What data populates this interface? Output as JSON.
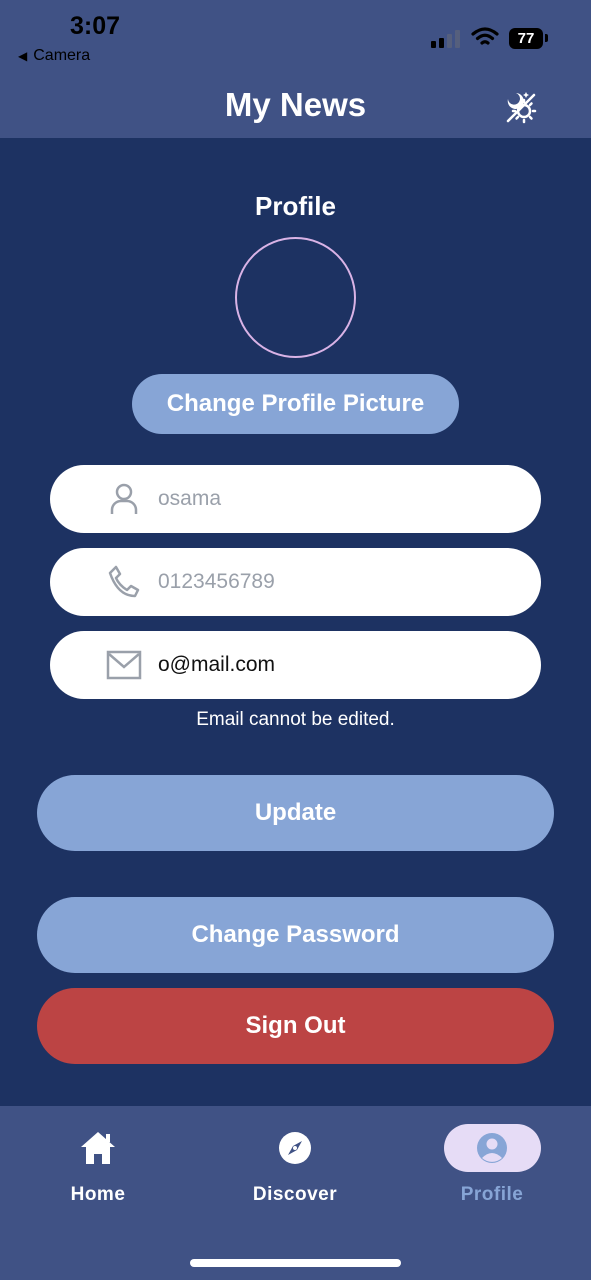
{
  "status_bar": {
    "time": "3:07",
    "back_label": "Camera",
    "battery": "77"
  },
  "header": {
    "title": "My News",
    "theme_icon": "day-night-toggle-icon"
  },
  "profile": {
    "section_title": "Profile",
    "change_picture_label": "Change Profile Picture",
    "fields": {
      "name": {
        "icon": "person-icon",
        "value": "osama"
      },
      "phone": {
        "icon": "phone-icon",
        "value": "0123456789"
      },
      "email": {
        "icon": "mail-icon",
        "value": "o@mail.com"
      }
    },
    "email_note": "Email cannot be edited.",
    "update_label": "Update",
    "change_password_label": "Change Password",
    "sign_out_label": "Sign Out"
  },
  "nav": {
    "items": [
      {
        "label": "Home",
        "icon": "home-icon",
        "active": false
      },
      {
        "label": "Discover",
        "icon": "compass-icon",
        "active": false
      },
      {
        "label": "Profile",
        "icon": "profile-icon",
        "active": true
      }
    ]
  },
  "colors": {
    "background": "#1d3262",
    "header": "#405285",
    "accent_button": "#87a5d6",
    "danger_button": "#bc4444",
    "active_nav_pill": "#e6dcf6"
  }
}
